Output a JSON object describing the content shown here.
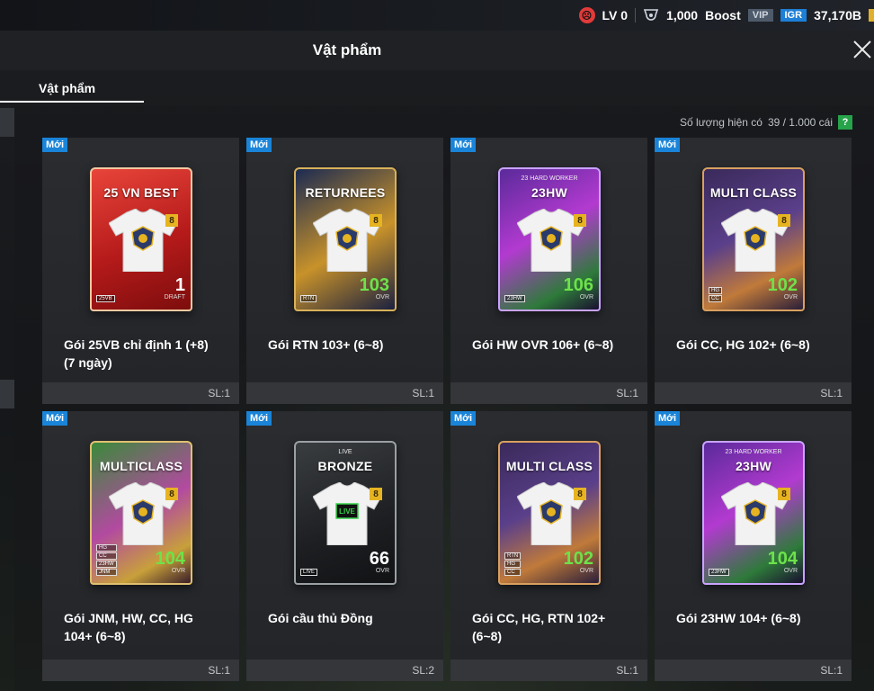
{
  "topbar": {
    "level": "LV 0",
    "coins": "1,000",
    "boost_label": "Boost",
    "vip": "VIP",
    "igr": "IGR",
    "bp": "37,170B"
  },
  "header": {
    "title": "Vật phẩm"
  },
  "tabs": [
    {
      "label": "Vật phẩm"
    }
  ],
  "stock": {
    "label": "Số lượng hiện có",
    "value": "39 / 1.000 cái",
    "help": "?"
  },
  "colors": {
    "new_badge": "#1a84d8",
    "help": "#27a34a",
    "ovr_green": "#6de24a",
    "igr": "#1d7fd6"
  },
  "items": [
    {
      "badge": "Mới",
      "pack_title": "25 VN BEST",
      "pack_sub": "",
      "name_line1": "Gói 25VB chỉ định 1 (+8)",
      "name_line2": "(7 ngày)",
      "ovr": "1",
      "ovr_label": "DRAFT",
      "tags": [
        "25VB"
      ],
      "qty": "SL:1",
      "style": "red"
    },
    {
      "badge": "Mới",
      "pack_title": "RETURNEES",
      "pack_sub": "",
      "name_line1": "Gói RTN 103+ (6~8)",
      "name_line2": "",
      "ovr": "103",
      "ovr_label": "OVR",
      "tags": [
        "RTN"
      ],
      "qty": "SL:1",
      "style": "navy"
    },
    {
      "badge": "Mới",
      "pack_title": "23HW",
      "pack_sub": "23 HARD WORKER",
      "name_line1": "Gói HW OVR 106+ (6~8)",
      "name_line2": "",
      "ovr": "106",
      "ovr_label": "OVR",
      "tags": [
        "23HW"
      ],
      "qty": "SL:1",
      "style": "purple"
    },
    {
      "badge": "Mới",
      "pack_title": "MULTI CLASS",
      "pack_sub": "",
      "name_line1": "Gói CC, HG 102+ (6~8)",
      "name_line2": "",
      "ovr": "102",
      "ovr_label": "OVR",
      "tags": [
        "HG",
        "CC"
      ],
      "qty": "SL:1",
      "style": "violet"
    },
    {
      "badge": "Mới",
      "pack_title": "MULTICLASS",
      "pack_sub": "",
      "name_line1": "Gói JNM, HW, CC, HG",
      "name_line2": "104+ (6~8)",
      "ovr": "104",
      "ovr_label": "OVR",
      "tags": [
        "HG",
        "CC",
        "23HW",
        "JNM"
      ],
      "qty": "SL:1",
      "style": "green"
    },
    {
      "badge": "Mới",
      "pack_title": "BRONZE",
      "pack_sub": "LIVE",
      "name_line1": "Gói cầu thủ Đồng",
      "name_line2": "",
      "ovr": "66",
      "ovr_label": "OVR",
      "tags": [
        "LIVE"
      ],
      "qty": "SL:2",
      "style": "dark"
    },
    {
      "badge": "Mới",
      "pack_title": "MULTI CLASS",
      "pack_sub": "",
      "name_line1": "Gói CC, HG, RTN 102+",
      "name_line2": "(6~8)",
      "ovr": "102",
      "ovr_label": "OVR",
      "tags": [
        "RTN",
        "HG",
        "CC"
      ],
      "qty": "SL:1",
      "style": "violet"
    },
    {
      "badge": "Mới",
      "pack_title": "23HW",
      "pack_sub": "23 HARD WORKER",
      "name_line1": "Gói 23HW 104+ (6~8)",
      "name_line2": "",
      "ovr": "104",
      "ovr_label": "OVR",
      "tags": [
        "23HW"
      ],
      "qty": "SL:1",
      "style": "purple"
    }
  ]
}
